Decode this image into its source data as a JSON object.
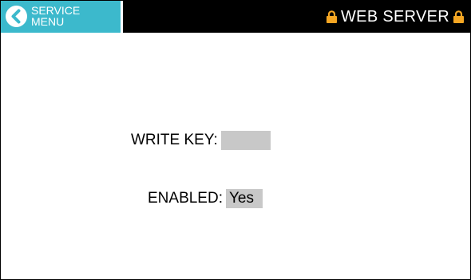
{
  "header": {
    "back_button_label": "SERVICE\nMENU",
    "title": "WEB SERVER",
    "accent_color": "#3cb9cc",
    "lock_color": "#f5a623"
  },
  "fields": {
    "write_key": {
      "label": "WRITE KEY:",
      "value": ""
    },
    "enabled": {
      "label": "ENABLED:",
      "value": "Yes"
    }
  },
  "icons": {
    "back": "chevron-left-circle-icon",
    "lock": "lock-icon"
  }
}
